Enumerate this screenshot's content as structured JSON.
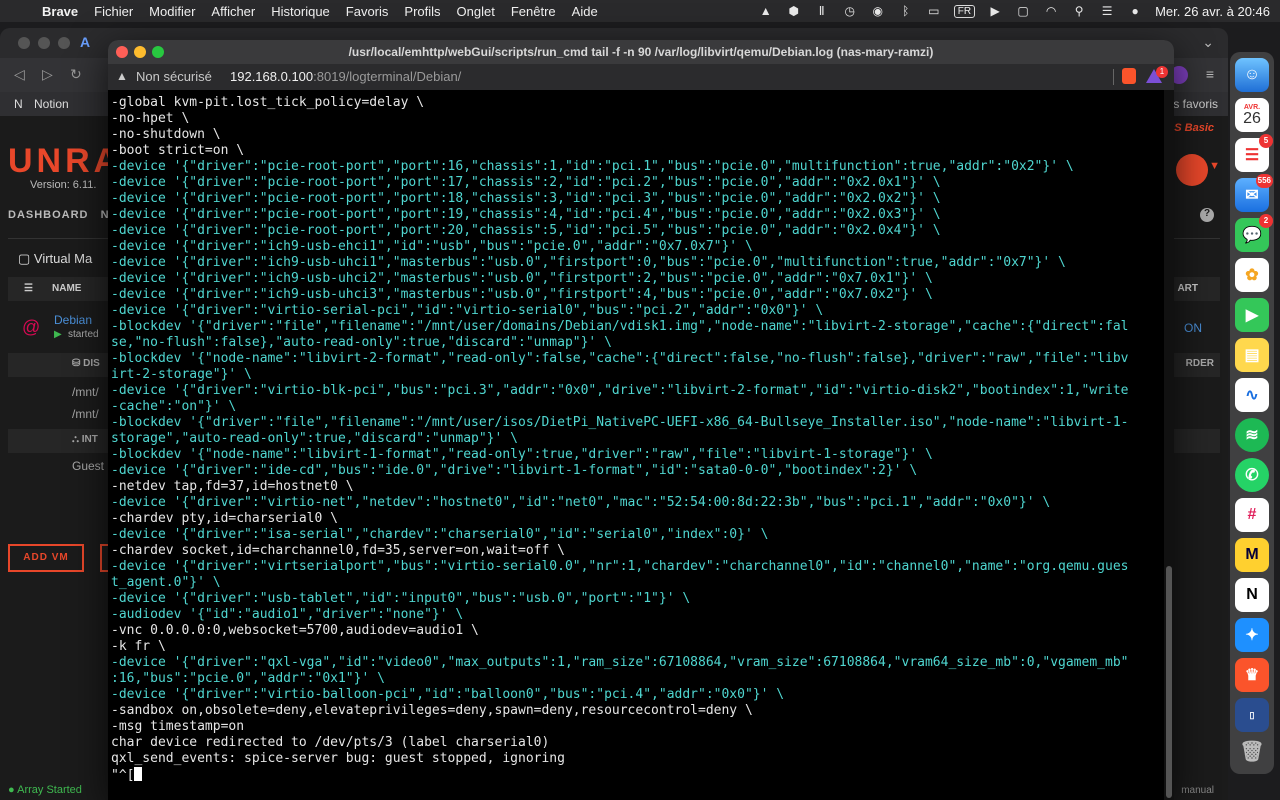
{
  "menubar": {
    "app": "Brave",
    "items": [
      "Fichier",
      "Modifier",
      "Afficher",
      "Historique",
      "Favoris",
      "Profils",
      "Onglet",
      "Fenêtre",
      "Aide"
    ],
    "input_source": "FR",
    "datetime": "Mer. 26 avr. à 20:46"
  },
  "background_page": {
    "bookmarks": [
      "Notion"
    ],
    "bookmarks_right": "es favoris",
    "logo": "UNRA",
    "version": "Version: 6.11.",
    "plan": "OS Basic",
    "nav_first": "DASHBOARD",
    "nav_second": "N",
    "section_title": "Virtual Ma",
    "col_name": "NAME",
    "col_right": "ART",
    "vm_name": "Debian",
    "vm_state": "started",
    "vm_link": "ON",
    "disk_hdr": "DIS",
    "disk_right": "RDER",
    "disk1": "/mnt/",
    "disk2": "/mnt/",
    "net_hdr": "INT",
    "net_row": "Guest",
    "add_vm": "ADD VM",
    "status": "Array Started",
    "manual": "manual"
  },
  "dock": {
    "calendar_month": "AVR.",
    "calendar_day": "26",
    "badges": {
      "reminders": "5",
      "mail": "556",
      "messages": "2"
    }
  },
  "window": {
    "title": "/usr/local/emhttp/webGui/scripts/run_cmd tail -f -n 90 /var/log/libvirt/qemu/Debian.log (nas-mary-ramzi)",
    "security": "Non sécurisé",
    "url_host": "192.168.0.100",
    "url_rest": ":8019/logterminal/Debian/",
    "notif_count": "1"
  },
  "terminal": {
    "lines": [
      {
        "t": "-global kvm-pit.lost_tick_policy=delay \\",
        "c": "w"
      },
      {
        "t": "-no-hpet \\",
        "c": "w"
      },
      {
        "t": "-no-shutdown \\",
        "c": "w"
      },
      {
        "t": "-boot strict=on \\",
        "c": "w"
      },
      {
        "t": "-device '{\"driver\":\"pcie-root-port\",\"port\":16,\"chassis\":1,\"id\":\"pci.1\",\"bus\":\"pcie.0\",\"multifunction\":true,\"addr\":\"0x2\"}' \\",
        "c": "c"
      },
      {
        "t": "-device '{\"driver\":\"pcie-root-port\",\"port\":17,\"chassis\":2,\"id\":\"pci.2\",\"bus\":\"pcie.0\",\"addr\":\"0x2.0x1\"}' \\",
        "c": "c"
      },
      {
        "t": "-device '{\"driver\":\"pcie-root-port\",\"port\":18,\"chassis\":3,\"id\":\"pci.3\",\"bus\":\"pcie.0\",\"addr\":\"0x2.0x2\"}' \\",
        "c": "c"
      },
      {
        "t": "-device '{\"driver\":\"pcie-root-port\",\"port\":19,\"chassis\":4,\"id\":\"pci.4\",\"bus\":\"pcie.0\",\"addr\":\"0x2.0x3\"}' \\",
        "c": "c"
      },
      {
        "t": "-device '{\"driver\":\"pcie-root-port\",\"port\":20,\"chassis\":5,\"id\":\"pci.5\",\"bus\":\"pcie.0\",\"addr\":\"0x2.0x4\"}' \\",
        "c": "c"
      },
      {
        "t": "-device '{\"driver\":\"ich9-usb-ehci1\",\"id\":\"usb\",\"bus\":\"pcie.0\",\"addr\":\"0x7.0x7\"}' \\",
        "c": "c"
      },
      {
        "t": "-device '{\"driver\":\"ich9-usb-uhci1\",\"masterbus\":\"usb.0\",\"firstport\":0,\"bus\":\"pcie.0\",\"multifunction\":true,\"addr\":\"0x7\"}' \\",
        "c": "c"
      },
      {
        "t": "-device '{\"driver\":\"ich9-usb-uhci2\",\"masterbus\":\"usb.0\",\"firstport\":2,\"bus\":\"pcie.0\",\"addr\":\"0x7.0x1\"}' \\",
        "c": "c"
      },
      {
        "t": "-device '{\"driver\":\"ich9-usb-uhci3\",\"masterbus\":\"usb.0\",\"firstport\":4,\"bus\":\"pcie.0\",\"addr\":\"0x7.0x2\"}' \\",
        "c": "c"
      },
      {
        "t": "-device '{\"driver\":\"virtio-serial-pci\",\"id\":\"virtio-serial0\",\"bus\":\"pci.2\",\"addr\":\"0x0\"}' \\",
        "c": "c"
      },
      {
        "t": "-blockdev '{\"driver\":\"file\",\"filename\":\"/mnt/user/domains/Debian/vdisk1.img\",\"node-name\":\"libvirt-2-storage\",\"cache\":{\"direct\":fal",
        "c": "c"
      },
      {
        "t": "se,\"no-flush\":false},\"auto-read-only\":true,\"discard\":\"unmap\"}' \\",
        "c": "c"
      },
      {
        "t": "-blockdev '{\"node-name\":\"libvirt-2-format\",\"read-only\":false,\"cache\":{\"direct\":false,\"no-flush\":false},\"driver\":\"raw\",\"file\":\"libv",
        "c": "c"
      },
      {
        "t": "irt-2-storage\"}' \\",
        "c": "c"
      },
      {
        "t": "-device '{\"driver\":\"virtio-blk-pci\",\"bus\":\"pci.3\",\"addr\":\"0x0\",\"drive\":\"libvirt-2-format\",\"id\":\"virtio-disk2\",\"bootindex\":1,\"write",
        "c": "c"
      },
      {
        "t": "-cache\":\"on\"}' \\",
        "c": "c"
      },
      {
        "t": "-blockdev '{\"driver\":\"file\",\"filename\":\"/mnt/user/isos/DietPi_NativePC-UEFI-x86_64-Bullseye_Installer.iso\",\"node-name\":\"libvirt-1-",
        "c": "c"
      },
      {
        "t": "storage\",\"auto-read-only\":true,\"discard\":\"unmap\"}' \\",
        "c": "c"
      },
      {
        "t": "-blockdev '{\"node-name\":\"libvirt-1-format\",\"read-only\":true,\"driver\":\"raw\",\"file\":\"libvirt-1-storage\"}' \\",
        "c": "c"
      },
      {
        "t": "-device '{\"driver\":\"ide-cd\",\"bus\":\"ide.0\",\"drive\":\"libvirt-1-format\",\"id\":\"sata0-0-0\",\"bootindex\":2}' \\",
        "c": "c"
      },
      {
        "t": "-netdev tap,fd=37,id=hostnet0 \\",
        "c": "w"
      },
      {
        "t": "-device '{\"driver\":\"virtio-net\",\"netdev\":\"hostnet0\",\"id\":\"net0\",\"mac\":\"52:54:00:8d:22:3b\",\"bus\":\"pci.1\",\"addr\":\"0x0\"}' \\",
        "c": "c"
      },
      {
        "t": "-chardev pty,id=charserial0 \\",
        "c": "w"
      },
      {
        "t": "-device '{\"driver\":\"isa-serial\",\"chardev\":\"charserial0\",\"id\":\"serial0\",\"index\":0}' \\",
        "c": "c"
      },
      {
        "t": "-chardev socket,id=charchannel0,fd=35,server=on,wait=off \\",
        "c": "w"
      },
      {
        "t": "-device '{\"driver\":\"virtserialport\",\"bus\":\"virtio-serial0.0\",\"nr\":1,\"chardev\":\"charchannel0\",\"id\":\"channel0\",\"name\":\"org.qemu.gues",
        "c": "c"
      },
      {
        "t": "t_agent.0\"}' \\",
        "c": "c"
      },
      {
        "t": "-device '{\"driver\":\"usb-tablet\",\"id\":\"input0\",\"bus\":\"usb.0\",\"port\":\"1\"}' \\",
        "c": "c"
      },
      {
        "t": "-audiodev '{\"id\":\"audio1\",\"driver\":\"none\"}' \\",
        "c": "c"
      },
      {
        "t": "-vnc 0.0.0.0:0,websocket=5700,audiodev=audio1 \\",
        "c": "w"
      },
      {
        "t": "-k fr \\",
        "c": "w"
      },
      {
        "t": "-device '{\"driver\":\"qxl-vga\",\"id\":\"video0\",\"max_outputs\":1,\"ram_size\":67108864,\"vram_size\":67108864,\"vram64_size_mb\":0,\"vgamem_mb\"",
        "c": "c"
      },
      {
        "t": ":16,\"bus\":\"pcie.0\",\"addr\":\"0x1\"}' \\",
        "c": "c"
      },
      {
        "t": "-device '{\"driver\":\"virtio-balloon-pci\",\"id\":\"balloon0\",\"bus\":\"pci.4\",\"addr\":\"0x0\"}' \\",
        "c": "c"
      },
      {
        "t": "-sandbox on,obsolete=deny,elevateprivileges=deny,spawn=deny,resourcecontrol=deny \\",
        "c": "w"
      },
      {
        "t": "-msg timestamp=on",
        "c": "w"
      },
      {
        "t": "char device redirected to /dev/pts/3 (label charserial0)",
        "c": "w"
      },
      {
        "t": "qxl_send_events: spice-server bug: guest stopped, ignoring",
        "c": "w"
      }
    ],
    "prompt": "\"^["
  }
}
